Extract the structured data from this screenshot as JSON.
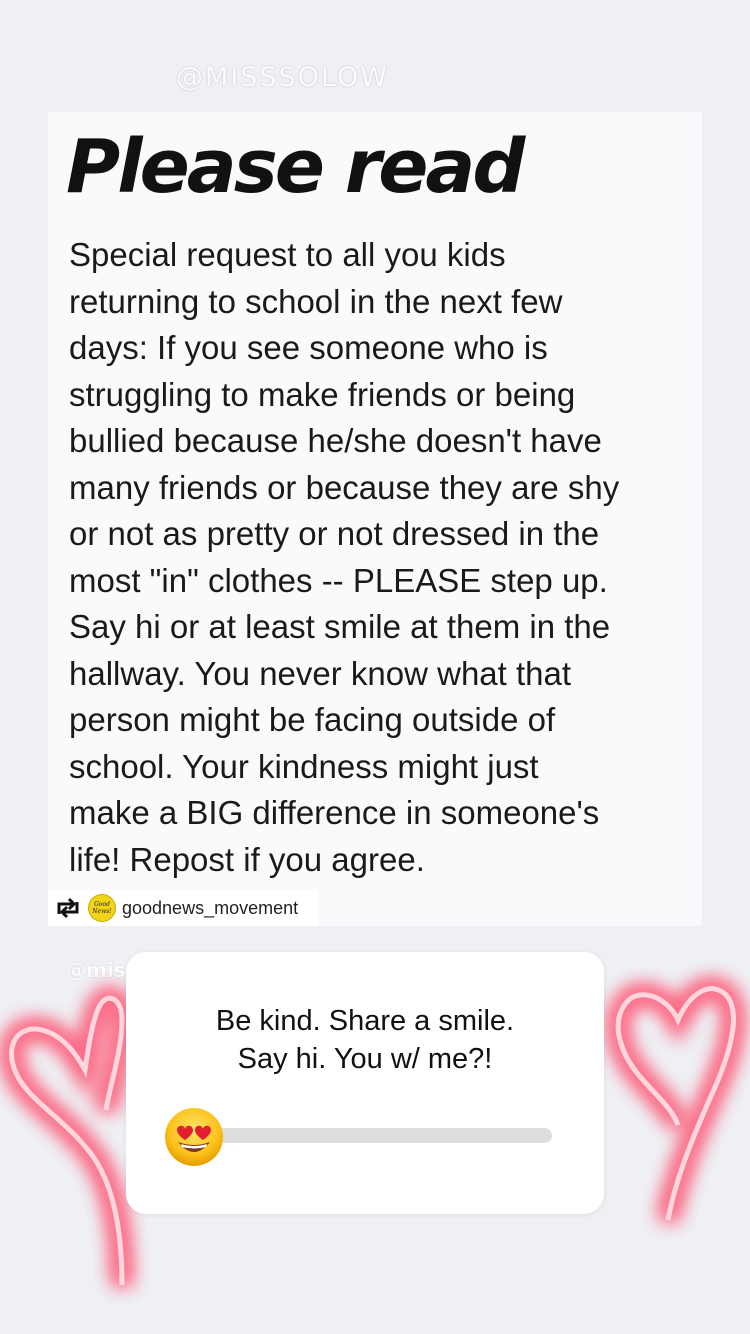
{
  "story": {
    "watermark_top": "@MISSSOLOW",
    "watermark_bottom": "@mis"
  },
  "repost": {
    "headline": "Please read",
    "body_lines": [
      "Special request to all you kids",
      "returning to school in the next few",
      "days: If you see someone who is",
      "struggling to make friends or being",
      "bullied because he/she doesn't have",
      "many friends or because they are shy",
      "or not as pretty or not dressed in the",
      "most \"in\" clothes -- PLEASE step up.",
      "Say hi or at least smile at them in the",
      "hallway. You never know what that",
      "person might be facing outside of",
      "school. Your kindness might just",
      "make a BIG difference in someone's",
      "life! Repost if you agree."
    ],
    "repost_icon": "repost-arrows-icon",
    "avatar_text": "Good News!",
    "username": "goodnews_movement"
  },
  "poll": {
    "question": "Be kind. Share a smile.\nSay hi. You w/ me?!",
    "emoji": "😍",
    "emoji_name": "heart-eyes-emoji-icon",
    "slider_value": 0
  },
  "decorations": {
    "left_icon": "neon-heart-icon",
    "right_icon": "neon-heart-icon",
    "neon_color": "#ff4d6d"
  },
  "colors": {
    "background": "#eef0f4",
    "card": "#f9fafc",
    "track": "#dedede"
  }
}
